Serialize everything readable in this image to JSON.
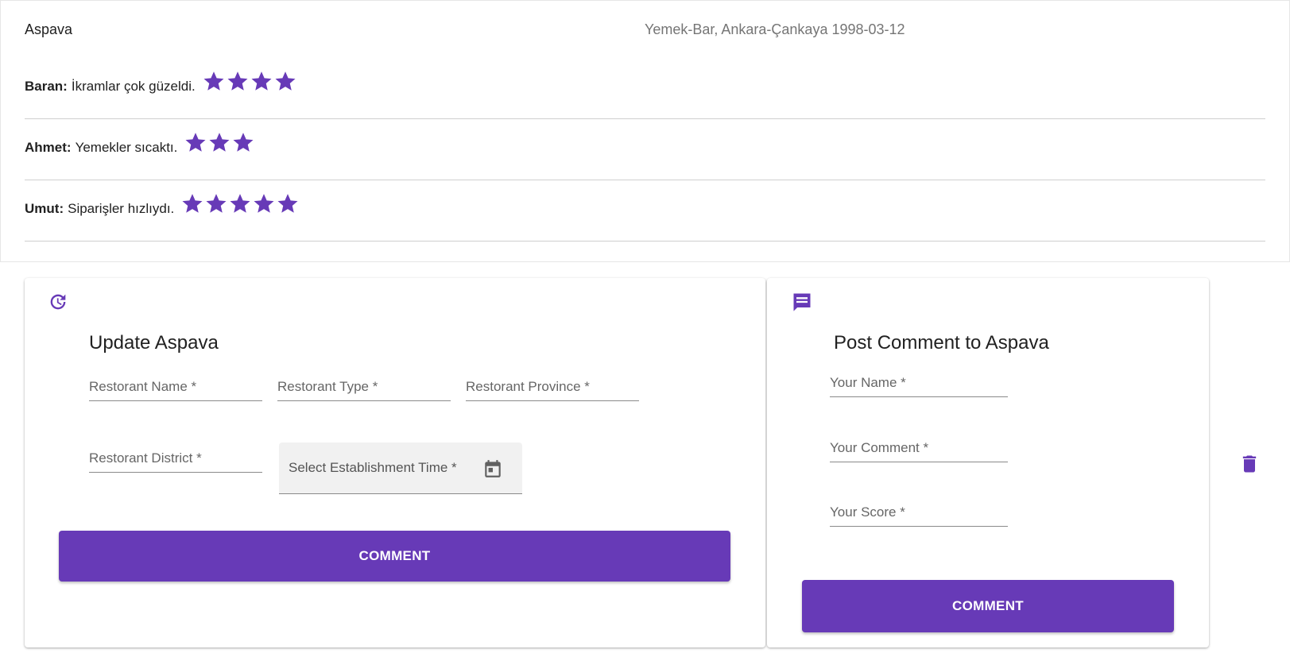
{
  "restaurant": {
    "name": "Aspava",
    "meta": "Yemek-Bar, Ankara-Çankaya 1998-03-12"
  },
  "comments": [
    {
      "user": "Baran:",
      "text": "İkramlar çok güzeldi.",
      "stars": 4
    },
    {
      "user": "Ahmet:",
      "text": "Yemekler sıcaktı.",
      "stars": 3
    },
    {
      "user": "Umut:",
      "text": "Siparişler hızlıydı.",
      "stars": 5
    }
  ],
  "update_form": {
    "icon": "update-icon",
    "title": "Update Aspava",
    "name_placeholder": "Restorant Name *",
    "type_placeholder": "Restorant Type *",
    "province_placeholder": "Restorant Province *",
    "district_placeholder": "Restorant District *",
    "date_label": "Select Establishment Time *",
    "date_icon": "calendar-icon",
    "submit_label": "COMMENT"
  },
  "comment_form": {
    "icon": "comment-icon",
    "title": "Post Comment to Aspava",
    "name_placeholder": "Your Name *",
    "comment_placeholder": "Your Comment *",
    "score_placeholder": "Your Score *",
    "submit_label": "COMMENT"
  },
  "actions": {
    "delete_icon": "trash-icon"
  },
  "colors": {
    "accent": "#673ab7",
    "meta_text": "#757575",
    "divider": "#cfcfcf"
  }
}
